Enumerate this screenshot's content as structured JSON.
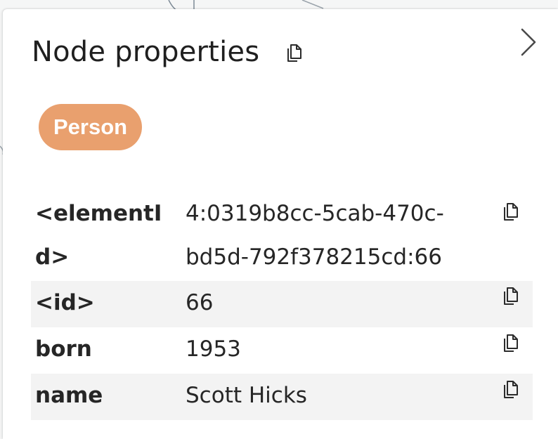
{
  "panel": {
    "title": "Node properties"
  },
  "node": {
    "labels": [
      "Person"
    ],
    "label_color": "#e9a06e",
    "properties": [
      {
        "key_line1": "<elementI",
        "key_line2": "d>",
        "value_line1": "4:0319b8cc-5cab-470c-",
        "value_line2": "bd5d-792f378215cd:66"
      },
      {
        "key": "<id>",
        "value": "66"
      },
      {
        "key": "born",
        "value": "1953"
      },
      {
        "key": "name",
        "value": "Scott Hicks"
      }
    ]
  },
  "icons": {
    "title_copy": "copy-icon",
    "collapse": "chevron-right-icon",
    "row_copy": "copy-icon"
  }
}
